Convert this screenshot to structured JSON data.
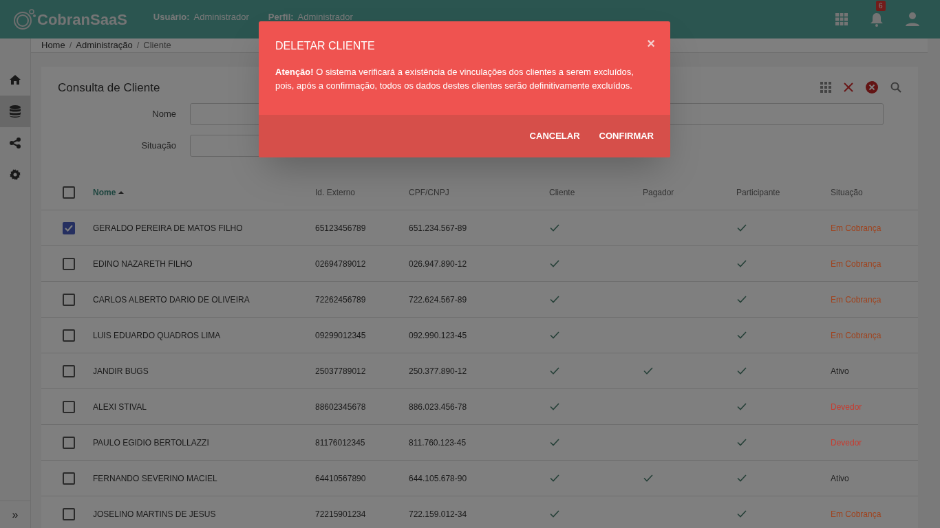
{
  "header": {
    "brand": "CobranSaaS",
    "user_label": "Usuário:",
    "user": "Administrador",
    "profile_label": "Perfil:",
    "profile": "Administrador",
    "notification_count": "6"
  },
  "sidebar": {
    "items": [
      {
        "kind": "home",
        "selected": false
      },
      {
        "kind": "database",
        "selected": true
      },
      {
        "kind": "share",
        "selected": false
      },
      {
        "kind": "settings",
        "selected": false
      }
    ],
    "expand": "»"
  },
  "breadcrumb": [
    {
      "label": "Home",
      "separator": "/"
    },
    {
      "label": "Administração",
      "separator": "/"
    },
    {
      "label": "Cliente"
    }
  ],
  "card": {
    "title": "Consulta de Cliente",
    "filters": [
      {
        "label": "Nome",
        "wide": true
      },
      {
        "label": "Situação",
        "wide": false
      }
    ]
  },
  "table": {
    "select_all": false,
    "columns": [
      {
        "label": "Nome",
        "sorted": true
      },
      {
        "label": "Id. Externo",
        "sorted": false
      },
      {
        "label": "CPF/CNPJ",
        "sorted": false
      },
      {
        "label": "Cliente",
        "sorted": false
      },
      {
        "label": "Pagador",
        "sorted": false
      },
      {
        "label": "Participante",
        "sorted": false
      },
      {
        "label": "Situação",
        "sorted": false
      }
    ],
    "rows": [
      {
        "selected": true,
        "name": "GERALDO PEREIRA DE MATOS FILHO",
        "external_id": "65123456789",
        "document": "651.234.567-89",
        "cliente": true,
        "pagador": false,
        "participante": true,
        "status": "Em Cobrança",
        "color": "#a0421c"
      },
      {
        "selected": false,
        "name": "EDINO NAZARETH FILHO",
        "external_id": "02694789012",
        "document": "026.947.890-12",
        "cliente": true,
        "pagador": false,
        "participante": true,
        "status": "Em Cobrança",
        "color": "#a0421c"
      },
      {
        "selected": false,
        "name": "CARLOS ALBERTO DARIO DE OLIVEIRA",
        "external_id": "72262456789",
        "document": "722.624.567-89",
        "cliente": true,
        "pagador": false,
        "participante": true,
        "status": "Em Cobrança",
        "color": "#a0421c"
      },
      {
        "selected": false,
        "name": "LUIS EDUARDO QUADROS LIMA",
        "external_id": "09299012345",
        "document": "092.990.123-45",
        "cliente": true,
        "pagador": false,
        "participante": true,
        "status": "Em Cobrança",
        "color": "#a0421c"
      },
      {
        "selected": false,
        "name": "JANDIR BUGS",
        "external_id": "25037789012",
        "document": "250.377.890-12",
        "cliente": true,
        "pagador": true,
        "participante": true,
        "status": "Ativo",
        "color": "#1e1e1e"
      },
      {
        "selected": false,
        "name": "ALEXI STIVAL",
        "external_id": "88602345678",
        "document": "886.023.456-78",
        "cliente": true,
        "pagador": false,
        "participante": true,
        "status": "Devedor",
        "color": "#c83a2e"
      },
      {
        "selected": false,
        "name": "PAULO EGIDIO BERTOLLAZZI",
        "external_id": "81176012345",
        "document": "811.760.123-45",
        "cliente": true,
        "pagador": false,
        "participante": true,
        "status": "Devedor",
        "color": "#c83a2e"
      },
      {
        "selected": false,
        "name": "FERNANDO SEVERINO MACIEL",
        "external_id": "64410567890",
        "document": "644.105.678-90",
        "cliente": true,
        "pagador": true,
        "participante": true,
        "status": "Ativo",
        "color": "#1e1e1e"
      },
      {
        "selected": false,
        "name": "JOSELINO MARTINS DE JESUS",
        "external_id": "72215901234",
        "document": "722.159.012-34",
        "cliente": true,
        "pagador": false,
        "participante": true,
        "status": "Em Cobrança",
        "color": "#a0421c"
      }
    ]
  },
  "dialog": {
    "title": "DELETAR CLIENTE",
    "close": "×",
    "message": "**Atenção!** O sistema verificará a existência de vinculações dos clientes a serem excluídos, pois, após a confirmação, todos os dados destes clientes serão definitivamente excluídos.",
    "buttons": [
      "CANCELAR",
      "CONFIRMAR"
    ]
  }
}
